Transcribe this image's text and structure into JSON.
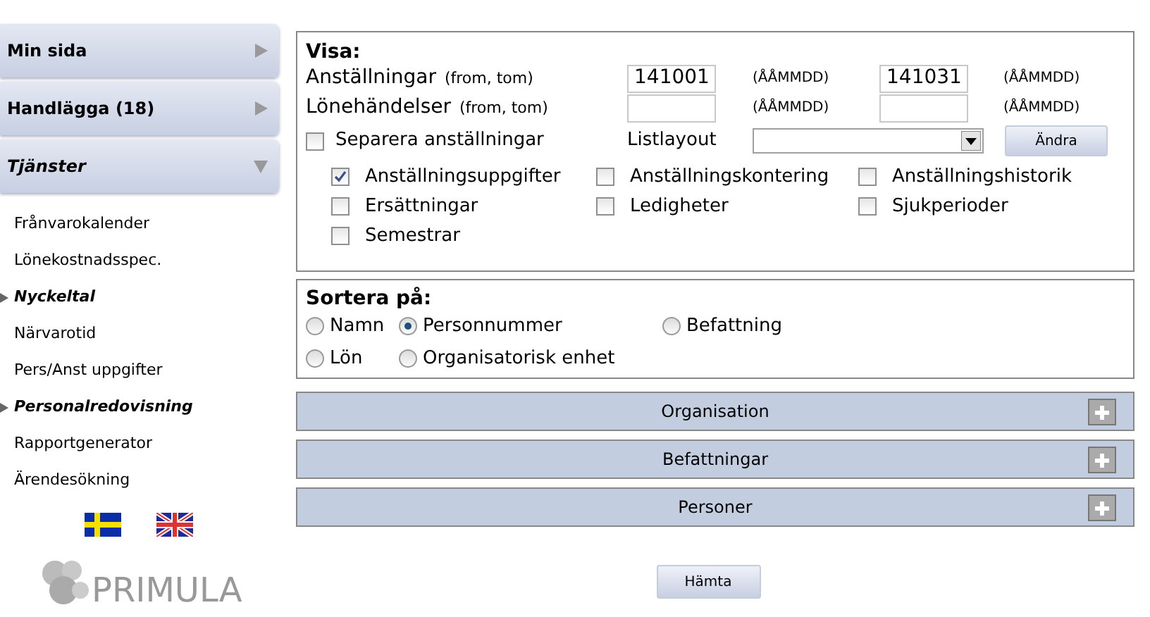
{
  "sidebar": {
    "sections": [
      {
        "label": "Min sida",
        "expanded": false
      },
      {
        "label": "Handlägga (18)",
        "expanded": false
      },
      {
        "label": "Tjänster",
        "expanded": true
      }
    ],
    "items": [
      {
        "label": "Frånvarokalender",
        "kind": "link"
      },
      {
        "label": "Lönekostnadsspec.",
        "kind": "link"
      },
      {
        "label": "Nyckeltal",
        "kind": "group"
      },
      {
        "label": "Närvarotid",
        "kind": "link"
      },
      {
        "label": "Pers/Anst uppgifter",
        "kind": "link"
      },
      {
        "label": "Personalredovisning",
        "kind": "group"
      },
      {
        "label": "Rapportgenerator",
        "kind": "link"
      },
      {
        "label": "Ärendesökning",
        "kind": "link"
      }
    ],
    "logo": "PRIMULA"
  },
  "visa": {
    "title": "Visa:",
    "ranges": [
      {
        "label": "Anställningar",
        "note": "(from, tom)",
        "from": "141001",
        "from_hint": "(ÅÅMMDD)",
        "to": "141031",
        "to_hint": "(ÅÅMMDD)"
      },
      {
        "label": "Lönehändelser",
        "note": "(from, tom)",
        "from_hint": "(ÅÅMMDD)",
        "to_hint": "(ÅÅMMDD)"
      }
    ],
    "separate": {
      "label": "Separera anställningar",
      "checked": false
    },
    "layout_label": "Listlayout",
    "change_button": "Ändra",
    "options": [
      {
        "label": "Anställningsuppgifter",
        "checked": true
      },
      {
        "label": "Anställningskontering",
        "checked": false
      },
      {
        "label": "Anställningshistorik",
        "checked": false
      },
      {
        "label": "Ersättningar",
        "checked": false
      },
      {
        "label": "Ledigheter",
        "checked": false
      },
      {
        "label": "Sjukperioder",
        "checked": false
      },
      {
        "label": "Semestrar",
        "checked": false
      }
    ]
  },
  "sort": {
    "title": "Sortera på:",
    "options": [
      {
        "label": "Namn",
        "selected": false
      },
      {
        "label": "Personnummer",
        "selected": true
      },
      {
        "label": "Befattning",
        "selected": false
      },
      {
        "label": "Lön",
        "selected": false
      },
      {
        "label": "Organisatorisk enhet",
        "selected": false
      }
    ]
  },
  "panels": [
    {
      "label": "Organisation",
      "expanded": false
    },
    {
      "label": "Befattningar",
      "expanded": false
    },
    {
      "label": "Personer",
      "expanded": false
    }
  ],
  "fetch_button": "Hämta"
}
